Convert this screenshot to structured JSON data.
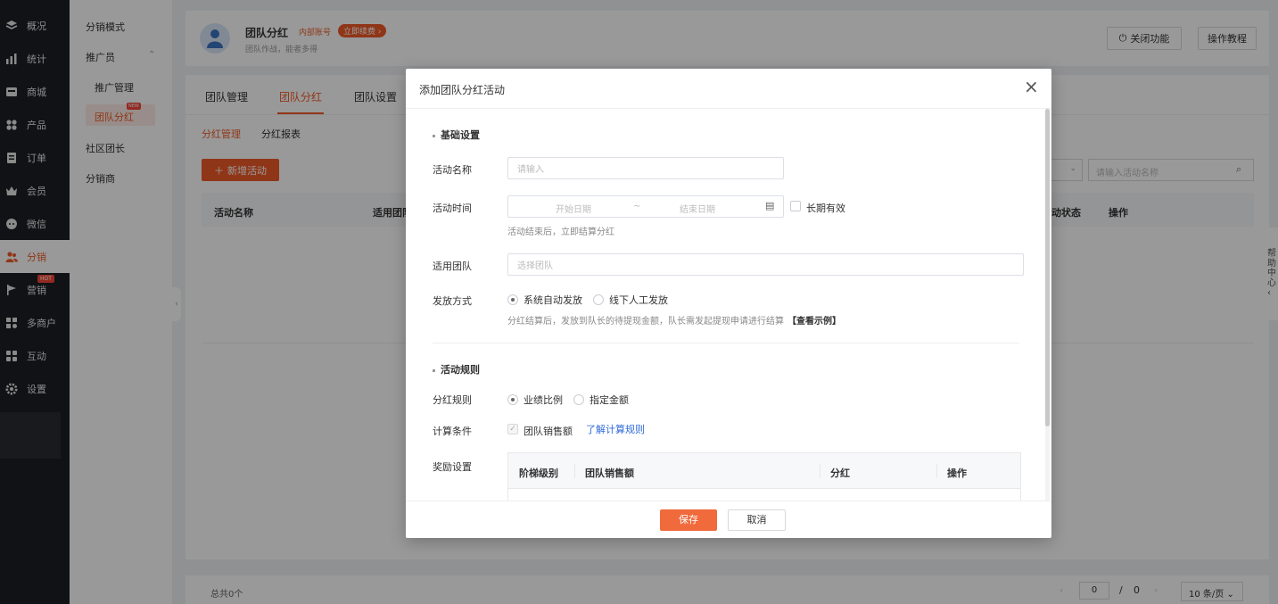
{
  "nav": {
    "items": [
      {
        "label": "概况",
        "icon": "layers-icon"
      },
      {
        "label": "统计",
        "icon": "bar-chart-icon"
      },
      {
        "label": "商城",
        "icon": "shop-icon"
      },
      {
        "label": "产品",
        "icon": "grid-icon"
      },
      {
        "label": "订单",
        "icon": "order-icon"
      },
      {
        "label": "会员",
        "icon": "crown-icon"
      },
      {
        "label": "微信",
        "icon": "chat-icon"
      },
      {
        "label": "分销",
        "icon": "users-icon"
      },
      {
        "label": "营销",
        "icon": "flag-icon",
        "badge": "HOT"
      },
      {
        "label": "多商户",
        "icon": "store-icon"
      },
      {
        "label": "互动",
        "icon": "apps-icon"
      },
      {
        "label": "设置",
        "icon": "gear-icon"
      }
    ]
  },
  "subnav": {
    "mode": "分销模式",
    "promoter": "推广员",
    "promoter_manage": "推广管理",
    "team_bonus": "团队分红",
    "new_badge": "NEW",
    "community": "社区团长",
    "distributor": "分销商"
  },
  "header": {
    "title": "团队分红",
    "tag_internal": "内部账号",
    "tag_renew": "立即续费",
    "subtitle": "团队作战，能者多得",
    "close_feature": "关闭功能",
    "tutorial": "操作教程"
  },
  "tabs": [
    "团队管理",
    "团队分红",
    "团队设置"
  ],
  "subtabs": [
    "分红管理",
    "分红报表"
  ],
  "toolbar": {
    "new_activity": "新增活动",
    "search_placeholder": "请输入活动名称"
  },
  "table": {
    "columns": [
      "活动名称",
      "适用团队",
      "活动状态",
      "操作"
    ]
  },
  "footer": {
    "total": "总共0个",
    "page_current": "0",
    "page_sep": "/",
    "page_total": "0",
    "page_size": "10 条/页"
  },
  "help": {
    "label": "帮助中心"
  },
  "modal": {
    "title": "添加团队分红活动",
    "basic_section": "基础设置",
    "name_label": "活动名称",
    "name_placeholder": "请输入",
    "time_label": "活动时间",
    "start_placeholder": "开始日期",
    "range_sep": "~",
    "end_placeholder": "结束日期",
    "long_term": "长期有效",
    "time_hint": "活动结束后，立即结算分红",
    "team_label": "适用团队",
    "team_placeholder": "选择团队",
    "pay_label": "发放方式",
    "pay_auto": "系统自动发放",
    "pay_manual": "线下人工发放",
    "pay_hint": "分红结算后，发放到队长的待提现金额，队长需发起提现申请进行结算",
    "pay_example": "【查看示例】",
    "rules_section": "活动规则",
    "rule_label": "分红规则",
    "rule_ratio": "业绩比例",
    "rule_fixed": "指定金额",
    "calc_label": "计算条件",
    "calc_team_sales": "团队销售额",
    "calc_link": "了解计算规则",
    "reward_label": "奖励设置",
    "reward_columns": [
      "阶梯级别",
      "团队销售额",
      "分红",
      "操作"
    ],
    "save": "保存",
    "cancel": "取消"
  },
  "colors": {
    "accent": "#f05a28",
    "nav_bg": "#1c1e23",
    "link": "#2f6bd8"
  }
}
